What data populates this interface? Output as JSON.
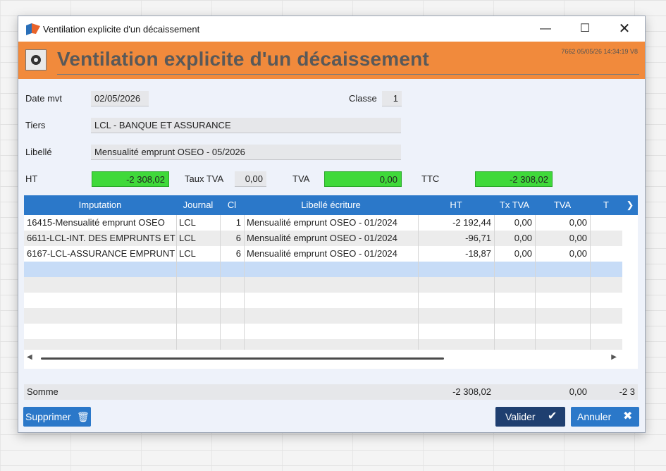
{
  "window": {
    "title": "Ventilation explicite d'un décaissement"
  },
  "banner": {
    "title": "Ventilation explicite d'un décaissement",
    "meta": "7662  05/05/26 14:34:19  V8"
  },
  "form": {
    "date_label": "Date mvt",
    "date_value": "02/05/2026",
    "classe_label": "Classe",
    "classe_value": "1",
    "tiers_label": "Tiers",
    "tiers_value": "LCL - BANQUE ET ASSURANCE",
    "libelle_label": "Libellé",
    "libelle_value": "Mensualité emprunt OSEO - 05/2026",
    "ht_label": "HT",
    "ht_value": "-2 308,02",
    "taux_tva_label": "Taux TVA",
    "taux_tva_value": "0,00",
    "tva_label": "TVA",
    "tva_value": "0,00",
    "ttc_label": "TTC",
    "ttc_value": "-2 308,02"
  },
  "grid": {
    "columns": [
      "Imputation",
      "Journal",
      "Cl",
      "Libellé  écriture",
      "HT",
      "Tx TVA",
      "TVA",
      "T"
    ],
    "rows": [
      [
        "16415-Mensualité emprunt OSEO",
        "LCL",
        "1",
        "Mensualité emprunt OSEO - 01/2024",
        "-2 192,44",
        "0,00",
        "0,00"
      ],
      [
        "6611-LCL-INT. DES EMPRUNTS ET",
        "LCL",
        "6",
        "Mensualité emprunt OSEO - 01/2024",
        "-96,71",
        "0,00",
        "0,00"
      ],
      [
        "6167-LCL-ASSURANCE EMPRUNT",
        "LCL",
        "6",
        "Mensualité emprunt OSEO - 01/2024",
        "-18,87",
        "0,00",
        "0,00"
      ]
    ]
  },
  "summary": {
    "label": "Somme",
    "ht": "-2 308,02",
    "tva": "0,00",
    "ttc": "-2 3"
  },
  "buttons": {
    "delete": "Supprimer",
    "validate": "Valider",
    "cancel": "Annuler"
  },
  "colors": {
    "banner": "#f18a3c",
    "header": "#2b78c9",
    "green": "#3fd93a"
  }
}
